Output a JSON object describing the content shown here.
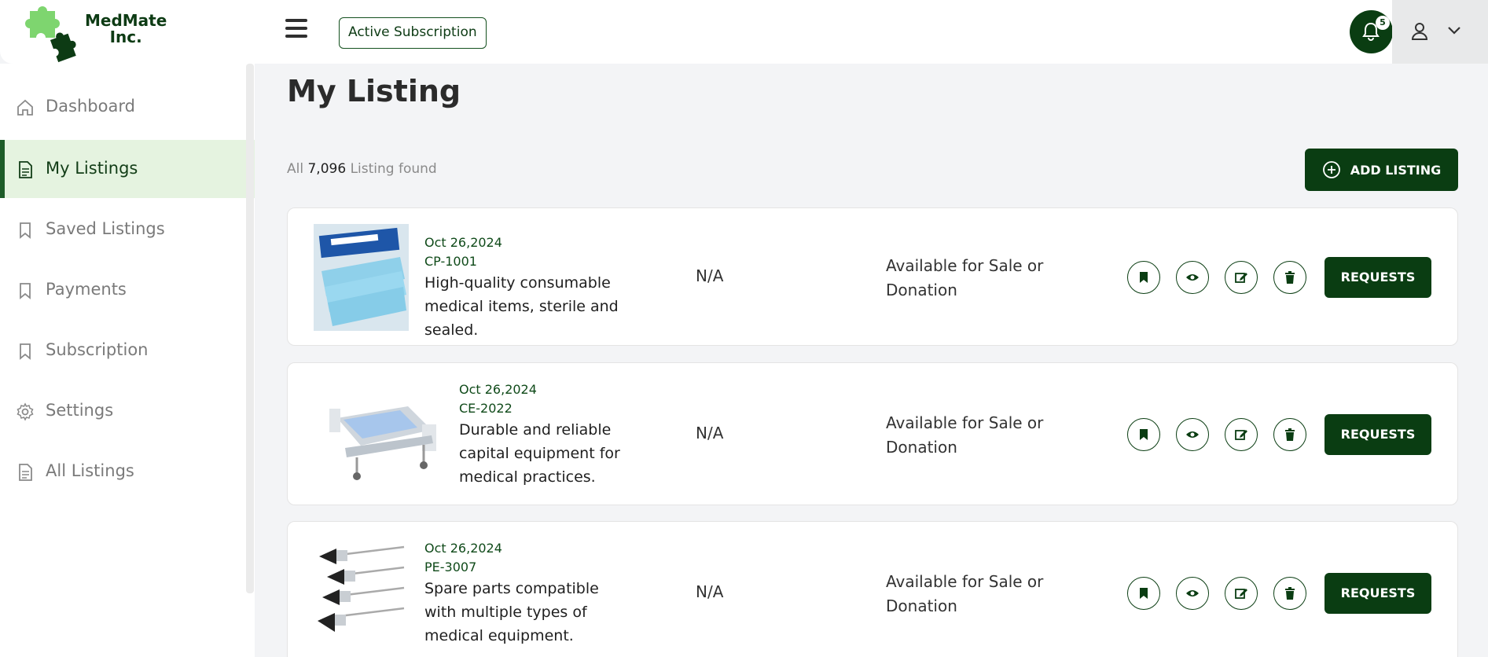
{
  "header": {
    "logo_line1": "MedMate",
    "logo_line2": "Inc.",
    "subscription_label": "Active Subscription",
    "notification_count": "5"
  },
  "sidebar": {
    "items": [
      {
        "label": "Dashboard",
        "icon": "home-icon"
      },
      {
        "label": "My Listings",
        "icon": "document-icon",
        "active": true
      },
      {
        "label": "Saved Listings",
        "icon": "bookmark-icon"
      },
      {
        "label": "Payments",
        "icon": "bookmark-icon"
      },
      {
        "label": "Subscription",
        "icon": "bookmark-icon"
      },
      {
        "label": "Settings",
        "icon": "gear-icon"
      },
      {
        "label": "All Listings",
        "icon": "document-icon"
      }
    ]
  },
  "main": {
    "title": "My Listing",
    "count_prefix": "All",
    "count_value": "7,096",
    "count_suffix": "Listing found",
    "add_label": "ADD LISTING",
    "listings": [
      {
        "date": "Oct 26,2024",
        "code": "CP-1001",
        "description": "High-quality consumable medical items, sterile and sealed.",
        "price": "N/A",
        "status": "Available for Sale or Donation",
        "request_label": "REQUESTS"
      },
      {
        "date": "Oct 26,2024",
        "code": "CE-2022",
        "description": "Durable and reliable capital equipment for medical practices.",
        "price": "N/A",
        "status": "Available for Sale or Donation",
        "request_label": "REQUESTS"
      },
      {
        "date": "Oct 26,2024",
        "code": "PE-3007",
        "description": "Spare parts compatible with multiple types of medical equipment.",
        "price": "N/A",
        "status": "Available for Sale or Donation",
        "request_label": "REQUESTS"
      }
    ]
  },
  "colors": {
    "brand_dark": "#0a3d12",
    "active_bg": "#e5f3e0",
    "logo_light": "#7ed56f"
  }
}
